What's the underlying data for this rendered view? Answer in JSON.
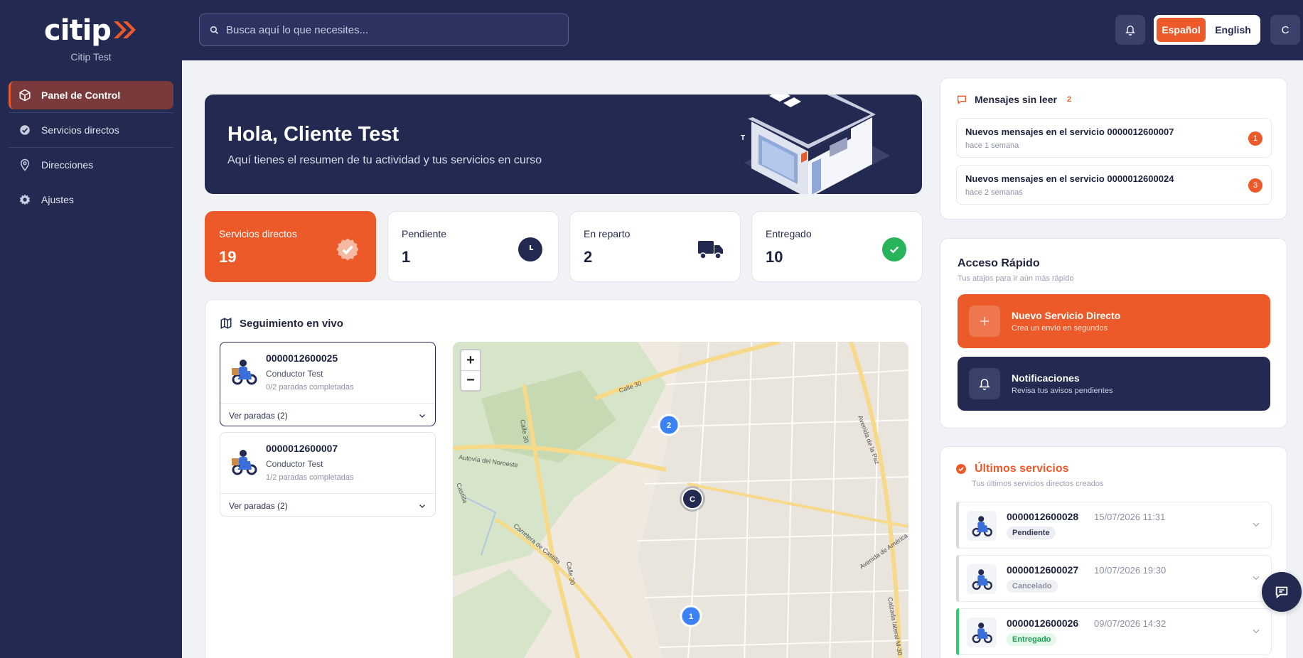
{
  "brand": {
    "logo_main": "citip",
    "logo_arrows": "»",
    "company": "Citip Test"
  },
  "sidebar": {
    "items": [
      {
        "label": "Panel de Control",
        "icon": "box-icon",
        "active": true
      },
      {
        "label": "Servicios directos",
        "icon": "check-badge-icon"
      },
      {
        "label": "Direcciones",
        "icon": "map-pin-icon"
      },
      {
        "label": "Ajustes",
        "icon": "gear-icon"
      }
    ]
  },
  "topbar": {
    "search_placeholder": "Busca aquí lo que necesites...",
    "lang_es": "Español",
    "lang_en": "English",
    "avatar_initial": "C"
  },
  "hero": {
    "title": "Hola, Cliente Test",
    "subtitle": "Aquí tienes el resumen de tu actividad y tus servicios en curso"
  },
  "stats": [
    {
      "label": "Servicios directos",
      "value": "19",
      "icon": "check-seal-icon"
    },
    {
      "label": "Pendiente",
      "value": "1",
      "icon": "clock-icon"
    },
    {
      "label": "En reparto",
      "value": "2",
      "icon": "truck-icon"
    },
    {
      "label": "Entregado",
      "value": "10",
      "icon": "check-circle-icon"
    }
  ],
  "live": {
    "title": "Seguimiento en vivo",
    "trips": [
      {
        "id": "0000012600025",
        "driver": "Conductor Test",
        "stops": "0/2 paradas completadas",
        "footer": "Ver paradas (2)"
      },
      {
        "id": "0000012600007",
        "driver": "Conductor Test",
        "stops": "1/2 paradas completadas",
        "footer": "Ver paradas (2)"
      }
    ],
    "map": {
      "zoom_in": "+",
      "zoom_out": "−",
      "markers": [
        "2",
        "C",
        "1"
      ],
      "street_labels": [
        "Calle 30",
        "Calle 30",
        "Calle 30",
        "Autovía del Noroeste",
        "Castilla",
        "Carretera de Castilla",
        "Avenida de la Paz",
        "Avenida de América",
        "Calzada lateral M-30"
      ]
    }
  },
  "messages": {
    "title": "Mensajes sin leer",
    "count": "2",
    "items": [
      {
        "title": "Nuevos mensajes en el servicio 0000012600007",
        "time": "hace 1 semana",
        "badge": "1"
      },
      {
        "title": "Nuevos mensajes en el servicio 0000012600024",
        "time": "hace 2 semanas",
        "badge": "3"
      }
    ]
  },
  "quick": {
    "title": "Acceso Rápido",
    "subtitle": "Tus atajos para ir aún más rápido",
    "buttons": [
      {
        "title": "Nuevo Servicio Directo",
        "subtitle": "Crea un envío en segundos"
      },
      {
        "title": "Notificaciones",
        "subtitle": "Revisa tus avisos pendientes"
      }
    ]
  },
  "latest": {
    "title": "Últimos servicios",
    "subtitle": "Tus últimos servicios directos creados",
    "items": [
      {
        "id": "0000012600028",
        "date": "15/07/2026 11:31",
        "status": "Pendiente",
        "color": "#d7d9e2",
        "bg": "#eceef3",
        "fg": "#3a3f5c"
      },
      {
        "id": "0000012600027",
        "date": "10/07/2026 19:30",
        "status": "Cancelado",
        "color": "#d7d9e2",
        "bg": "#f0f1f4",
        "fg": "#8a8fa3"
      },
      {
        "id": "0000012600026",
        "date": "09/07/2026 14:32",
        "status": "Entregado",
        "color": "#2ecc71",
        "bg": "#e3f7ea",
        "fg": "#1e9e52"
      }
    ]
  },
  "colors": {
    "accent": "#ec5a2a",
    "navy": "#232a52",
    "success": "#27b45a"
  }
}
